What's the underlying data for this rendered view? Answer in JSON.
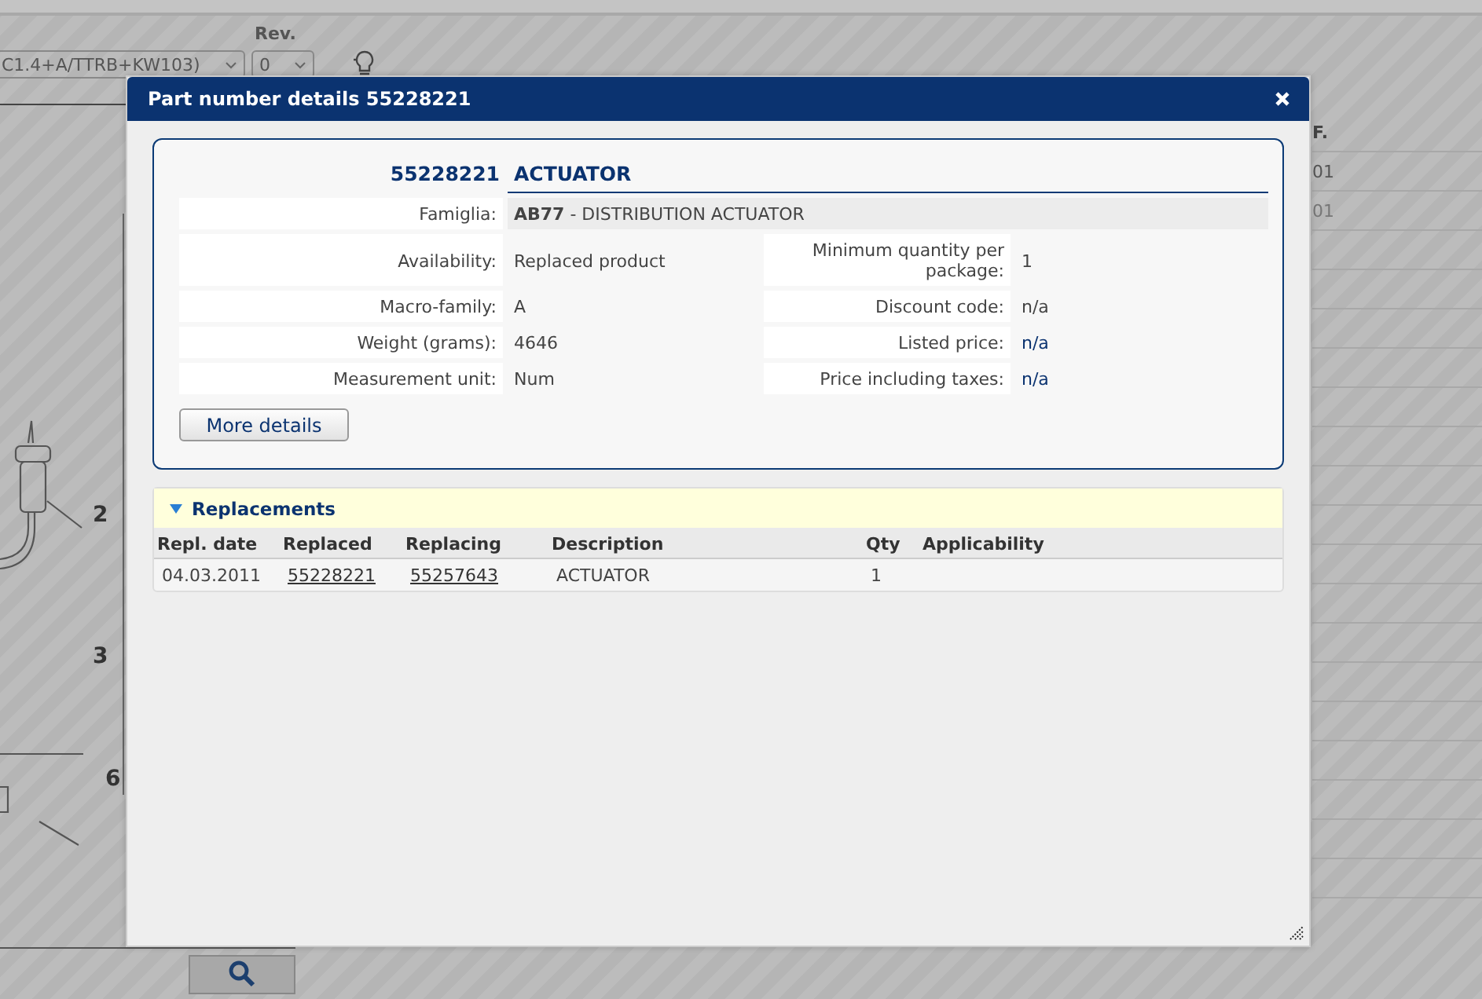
{
  "background": {
    "model_select": "C1.4+A/TTRB+KW103)",
    "rev_label": "Rev.",
    "rev_select": "0",
    "diagram_callouts": [
      "2",
      "3",
      "6"
    ],
    "side_table": {
      "header": "F.",
      "rows": [
        "01",
        "01"
      ]
    }
  },
  "dialog": {
    "title": "Part number details 55228221",
    "part": {
      "number": "55228221",
      "name": "ACTUATOR"
    },
    "family": {
      "label": "Famiglia:",
      "value": "**AB77** - DISTRIBUTION ACTUATOR"
    },
    "rows": [
      {
        "left": {
          "label": "Availability:",
          "value": "Replaced product"
        },
        "right": {
          "label": "Minimum quantity per package:",
          "value": "1",
          "kind": "plain"
        }
      },
      {
        "left": {
          "label": "Macro-family:",
          "value": "A"
        },
        "right": {
          "label": "Discount code:",
          "value": "n/a",
          "kind": "plain"
        }
      },
      {
        "left": {
          "label": "Weight (grams):",
          "value": "4646"
        },
        "right": {
          "label": "Listed price:",
          "value": "n/a",
          "kind": "price"
        }
      },
      {
        "left": {
          "label": "Measurement unit:",
          "value": "Num"
        },
        "right": {
          "label": "Price including taxes:",
          "value": "n/a",
          "kind": "price"
        }
      }
    ],
    "more_button": "More details",
    "replacements": {
      "title": "Replacements",
      "expanded": true,
      "columns": [
        "Repl. date",
        "Replaced",
        "Replacing",
        "Description",
        "Qty",
        "Applicability"
      ],
      "rows": [
        {
          "date": "04.03.2011",
          "replaced": "55228221",
          "replacing": "55257643",
          "description": "ACTUATOR",
          "qty": "1"
        }
      ]
    }
  }
}
